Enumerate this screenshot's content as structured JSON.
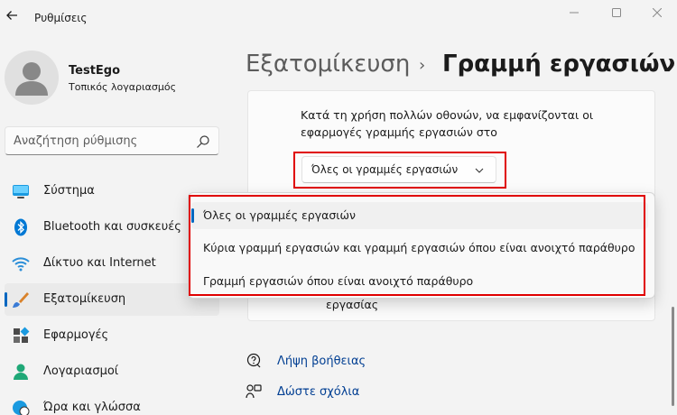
{
  "window": {
    "title": "Ρυθμίσεις"
  },
  "user": {
    "name": "TestEgo",
    "account_type": "Τοπικός λογαριασμός"
  },
  "search": {
    "placeholder": "Αναζήτηση ρύθμισης"
  },
  "nav": {
    "items": [
      {
        "label": "Σύστημα",
        "icon": "monitor-icon"
      },
      {
        "label": "Bluetooth και συσκευές",
        "icon": "bluetooth-icon"
      },
      {
        "label": "Δίκτυο και Internet",
        "icon": "wifi-icon"
      },
      {
        "label": "Εξατομίκευση",
        "icon": "brush-icon",
        "active": true
      },
      {
        "label": "Εφαρμογές",
        "icon": "apps-icon"
      },
      {
        "label": "Λογαριασμοί",
        "icon": "account-icon"
      },
      {
        "label": "Ώρα και γλώσσα",
        "icon": "globe-clock-icon"
      }
    ]
  },
  "breadcrumb": {
    "parent": "Εξατομίκευση",
    "separator": "›",
    "current": "Γραμμή εργασιών"
  },
  "setting": {
    "description": "Κατά τη χρήση πολλών οθονών, να εμφανίζονται οι εφαρμογές γραμμής εργασιών στο",
    "selected_value": "Όλες οι γραμμές εργασιών",
    "obscured_text": "εργασίας"
  },
  "dropdown": {
    "options": [
      {
        "label": "Όλες οι γραμμές εργασιών",
        "selected": true
      },
      {
        "label": "Κύρια γραμμή εργασιών και γραμμή εργασιών όπου είναι ανοιχτό παράθυρο"
      },
      {
        "label": "Γραμμή εργασιών όπου είναι ανοιχτό παράθυρο"
      }
    ]
  },
  "links": {
    "help": "Λήψη βοήθειας",
    "feedback": "Δώστε σχόλια"
  },
  "colors": {
    "accent": "#0067c0",
    "highlight_box": "#e00000",
    "link": "#003e92"
  }
}
